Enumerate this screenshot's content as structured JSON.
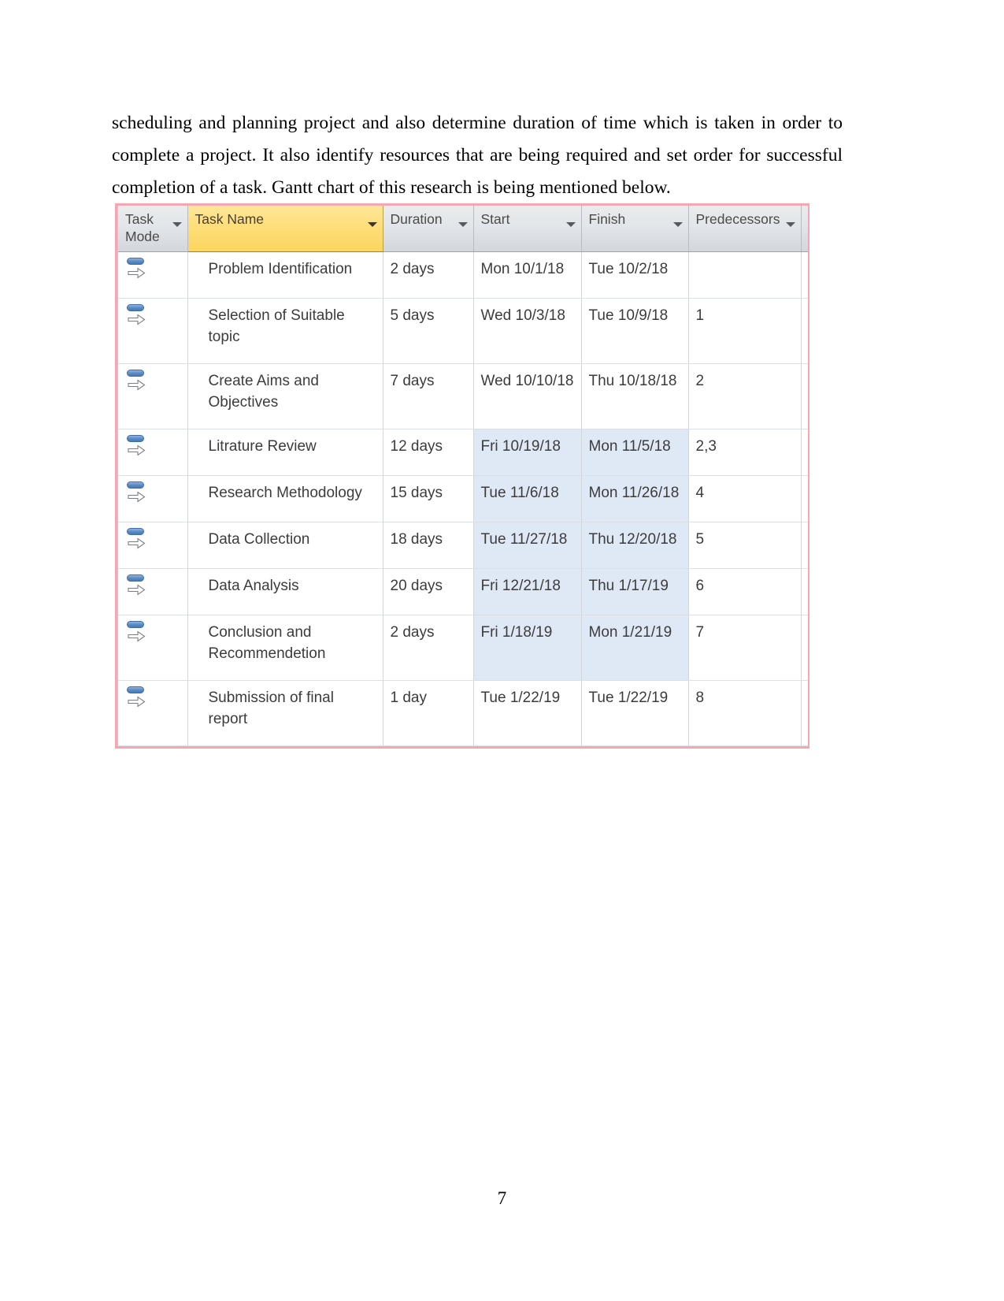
{
  "document": {
    "page_number": "7",
    "paragraph": "scheduling and planning project and also determine duration of time which is taken in order to complete a project. It also identify resources that are being required and set order for successful completion of a task. Gantt chart of this research is being mentioned below."
  },
  "gantt_table": {
    "columns": [
      {
        "label": "Task Mode",
        "key": "task_mode",
        "has_filter": true,
        "selected": false
      },
      {
        "label": "Task Name",
        "key": "task_name",
        "has_filter": true,
        "selected": true
      },
      {
        "label": "Duration",
        "key": "duration",
        "has_filter": true,
        "selected": false
      },
      {
        "label": "Start",
        "key": "start",
        "has_filter": true,
        "selected": false
      },
      {
        "label": "Finish",
        "key": "finish",
        "has_filter": true,
        "selected": false
      },
      {
        "label": "Predecessors",
        "key": "predecessors",
        "has_filter": true,
        "selected": false
      }
    ],
    "accent_selected_header": "#fbd55f",
    "accent_header": "#e2e5e9",
    "accent_cell_highlight": "#dfe9f5",
    "accent_frame_border": "#f4a7b2",
    "task_mode_icon": "auto-schedule-icon",
    "rows": [
      {
        "task_mode": "auto-schedule-icon",
        "task_name": "Problem Identification",
        "duration": "2 days",
        "start": "Mon 10/1/18",
        "finish": "Tue 10/2/18",
        "predecessors": ""
      },
      {
        "task_mode": "auto-schedule-icon",
        "task_name": "Selection of Suitable topic",
        "duration": "5 days",
        "start": "Wed 10/3/18",
        "finish": "Tue 10/9/18",
        "predecessors": "1"
      },
      {
        "task_mode": "auto-schedule-icon",
        "task_name": "Create Aims and Objectives",
        "duration": "7 days",
        "start": "Wed 10/10/18",
        "finish": "Thu 10/18/18",
        "predecessors": "2"
      },
      {
        "task_mode": "auto-schedule-icon",
        "task_name": "Litrature Review",
        "duration": "12 days",
        "start": "Fri 10/19/18",
        "finish": "Mon 11/5/18",
        "predecessors": "2,3"
      },
      {
        "task_mode": "auto-schedule-icon",
        "task_name": "Research Methodology",
        "duration": "15 days",
        "start": "Tue 11/6/18",
        "finish": "Mon 11/26/18",
        "predecessors": "4"
      },
      {
        "task_mode": "auto-schedule-icon",
        "task_name": "Data Collection",
        "duration": "18 days",
        "start": "Tue 11/27/18",
        "finish": "Thu 12/20/18",
        "predecessors": "5"
      },
      {
        "task_mode": "auto-schedule-icon",
        "task_name": "Data Analysis",
        "duration": "20 days",
        "start": "Fri 12/21/18",
        "finish": "Thu 1/17/19",
        "predecessors": "6"
      },
      {
        "task_mode": "auto-schedule-icon",
        "task_name": "Conclusion and Recommendetion",
        "duration": "2 days",
        "start": "Fri 1/18/19",
        "finish": "Mon 1/21/19",
        "predecessors": "7"
      },
      {
        "task_mode": "auto-schedule-icon",
        "task_name": "Submission of final report",
        "duration": "1 day",
        "start": "Tue 1/22/19",
        "finish": "Tue 1/22/19",
        "predecessors": "8"
      }
    ]
  }
}
